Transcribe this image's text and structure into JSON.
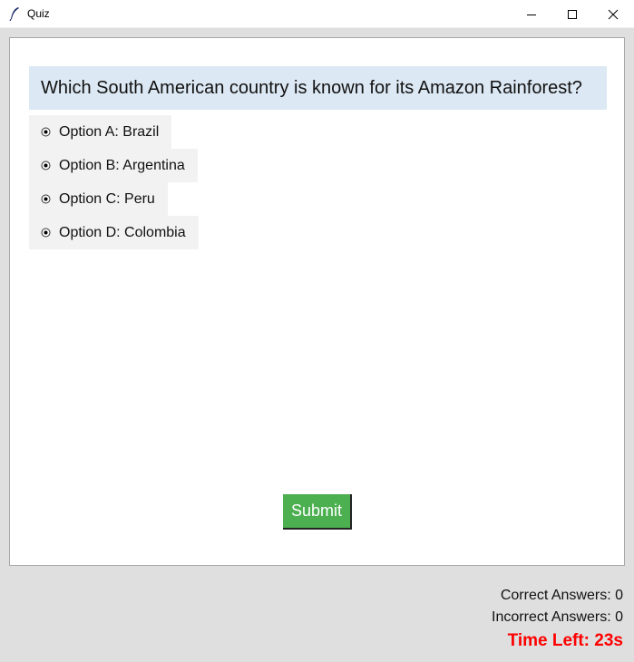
{
  "window": {
    "title": "Quiz",
    "controls": {
      "minimize": "minimize-icon",
      "maximize": "maximize-icon",
      "close": "close-icon"
    }
  },
  "quiz": {
    "question": "Which South American country is known for its Amazon Rainforest?",
    "options": [
      {
        "label": "Option A: Brazil"
      },
      {
        "label": "Option B: Argentina"
      },
      {
        "label": "Option C: Peru"
      },
      {
        "label": "Option D: Colombia"
      }
    ],
    "submit_label": "Submit"
  },
  "status": {
    "correct": "Correct Answers: 0",
    "incorrect": "Incorrect Answers: 0",
    "time_left": "Time Left: 23s"
  },
  "colors": {
    "question_bg": "#dce8f3",
    "option_bg": "#f2f2f2",
    "submit_bg": "#4caf50",
    "timer_text": "#ff0000"
  }
}
